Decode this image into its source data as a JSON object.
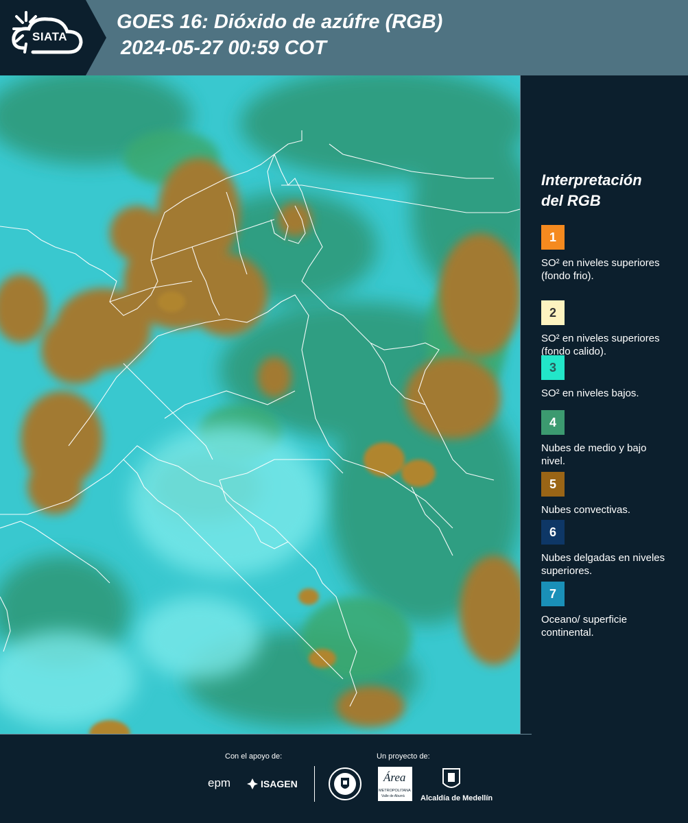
{
  "header": {
    "logo_text": "SIATA",
    "title_line1": "GOES 16: Dióxido de azúfre (RGB)",
    "title_line2": "2024-05-27 00:59 COT"
  },
  "legend": {
    "title_line1": "Interpretación",
    "title_line2": "del RGB",
    "items": [
      {
        "number": "1",
        "color": "#f58a1f",
        "text_color": "#ffffff",
        "label": "SO² en niveles superiores (fondo frio)."
      },
      {
        "number": "2",
        "color": "#fdf3c0",
        "text_color": "#333333",
        "label": "SO² en niveles superiores (fondo calido)."
      },
      {
        "number": "3",
        "color": "#22e6c9",
        "text_color": "#2b5b5a",
        "label": "SO² en niveles bajos."
      },
      {
        "number": "4",
        "color": "#3c9a70",
        "text_color": "#ffffff",
        "label": "Nubes de medio y bajo nivel."
      },
      {
        "number": "5",
        "color": "#9a6516",
        "text_color": "#ffffff",
        "label": "Nubes convectivas."
      },
      {
        "number": "6",
        "color": "#0e3766",
        "text_color": "#ffffff",
        "label": "Nubes delgadas en niveles superiores."
      },
      {
        "number": "7",
        "color": "#1a90b8",
        "text_color": "#ffffff",
        "label": "Oceano/ superficie continental."
      }
    ]
  },
  "footer": {
    "support_label": "Con el apoyo de:",
    "project_label": "Un proyecto de:",
    "epm_text": "epm",
    "isagen_text": "ISAGEN",
    "area_text": "Área",
    "area_sub": "METROPOLITANA",
    "area_sub2": "Valle de Aburrá",
    "alcaldia_text": "Alcaldía de Medellín"
  }
}
